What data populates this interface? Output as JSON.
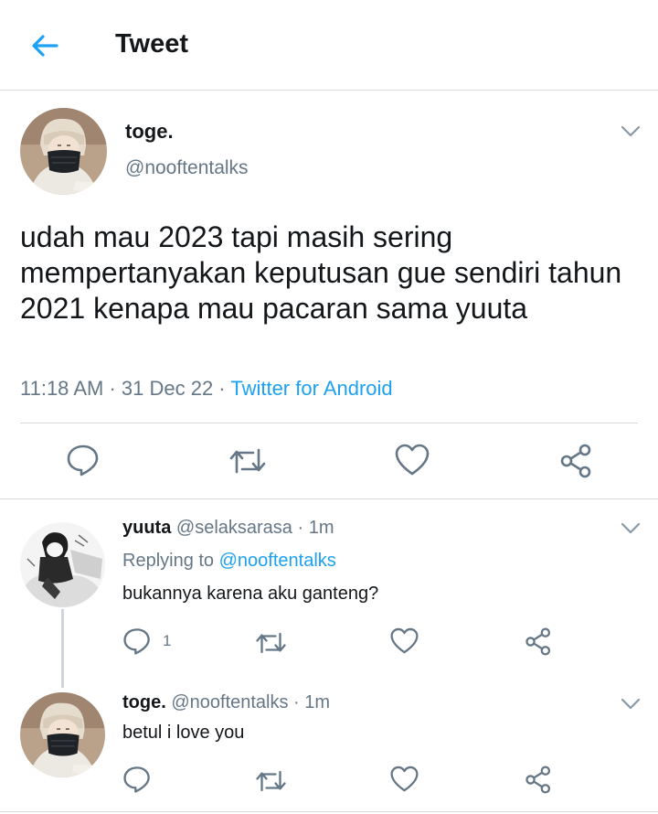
{
  "header": {
    "title": "Tweet",
    "back_icon": "arrow-left-icon",
    "accent": "#1da1f2"
  },
  "main_tweet": {
    "name": "toge.",
    "handle": "@nooftentalks",
    "text": "udah mau 2023 tapi masih sering mempertanyakan keputusan gue sendiri tahun 2021 kenapa mau pacaran sama yuuta",
    "time": "11:18 AM",
    "date": "31 Dec 22",
    "separator": " · ",
    "source": "Twitter for Android",
    "actions": [
      "reply-icon",
      "retweet-icon",
      "like-icon",
      "share-icon"
    ]
  },
  "replies": [
    {
      "name": "yuuta",
      "handle": "@selaksarasa",
      "time": "1m",
      "dot": " · ",
      "replying_prefix": "Replying to ",
      "replying_to": "@nooftentalks",
      "text": "bukannya karena aku ganteng?",
      "reply_count": "1"
    },
    {
      "name": "toge.",
      "handle": "@nooftentalks",
      "time": "1m",
      "dot": " · ",
      "text": "betul i love you"
    }
  ],
  "colors": {
    "text": "#14171a",
    "secondary": "#657786",
    "link": "#1da1f2",
    "divider": "#d6dadd"
  }
}
